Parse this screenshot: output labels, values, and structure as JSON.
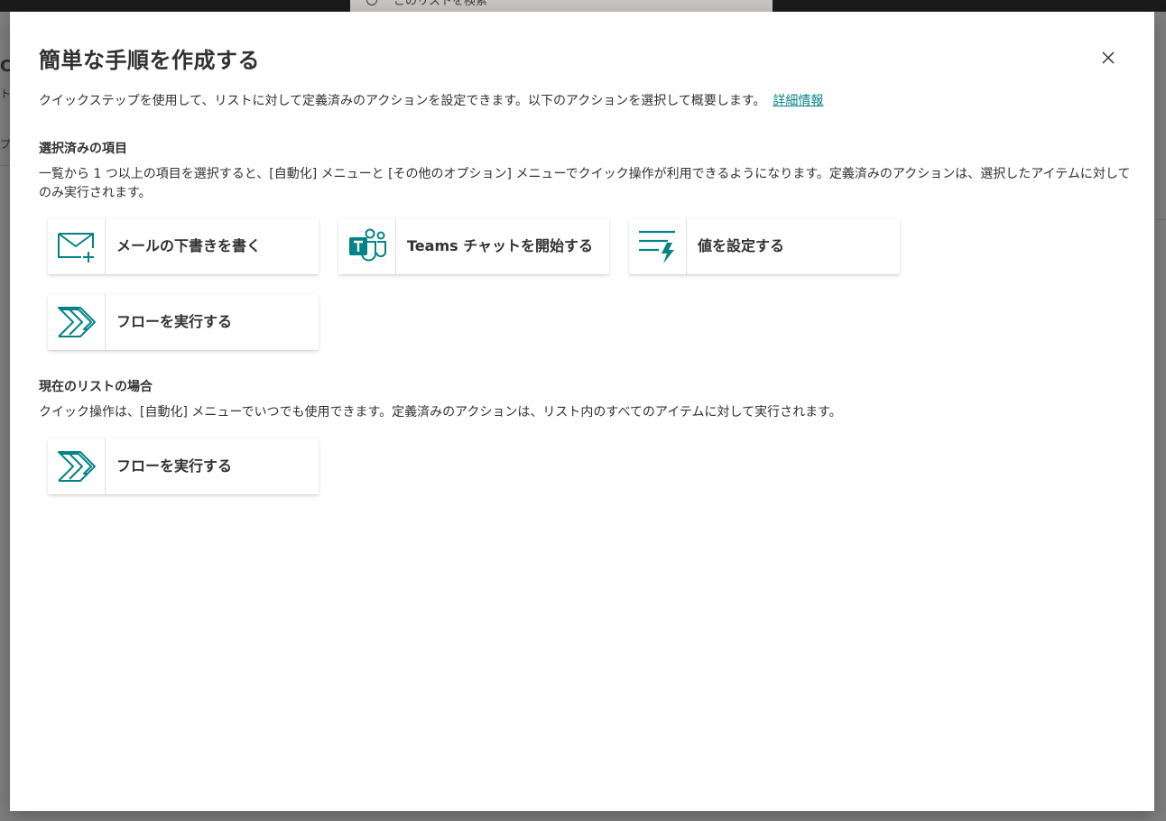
{
  "background": {
    "search_placeholder": "このリストを検索",
    "frag_left_1": "C",
    "frag_left_2": "ト",
    "frag_left_3": "プ"
  },
  "dialog": {
    "title": "簡単な手順を作成する",
    "close_label": "×",
    "description": "クイックステップを使用して、リストに対して定義済みのアクションを設定できます。以下のアクションを選択して概要します。",
    "learn_more": "詳細情報",
    "accent_color": "#038387"
  },
  "selected_items": {
    "heading": "選択済みの項目",
    "description": "一覧から 1 つ以上の項目を選択すると、[自動化] メニューと [その他のオプション] メニューでクイック操作が利用できるようになります。定義済みのアクションは、選択したアイテムに対してのみ実行されます。",
    "actions": [
      {
        "label": "メールの下書きを書く",
        "icon": "mail-add-icon"
      },
      {
        "label": "Teams チャットを開始する",
        "icon": "teams-icon"
      },
      {
        "label": "値を設定する",
        "icon": "set-value-icon"
      },
      {
        "label": "フローを実行する",
        "icon": "power-automate-icon"
      }
    ]
  },
  "current_list": {
    "heading": "現在のリストの場合",
    "description": "クイック操作は、[自動化] メニューでいつでも使用できます。定義済みのアクションは、リスト内のすべてのアイテムに対して実行されます。",
    "actions": [
      {
        "label": "フローを実行する",
        "icon": "power-automate-icon"
      }
    ]
  }
}
